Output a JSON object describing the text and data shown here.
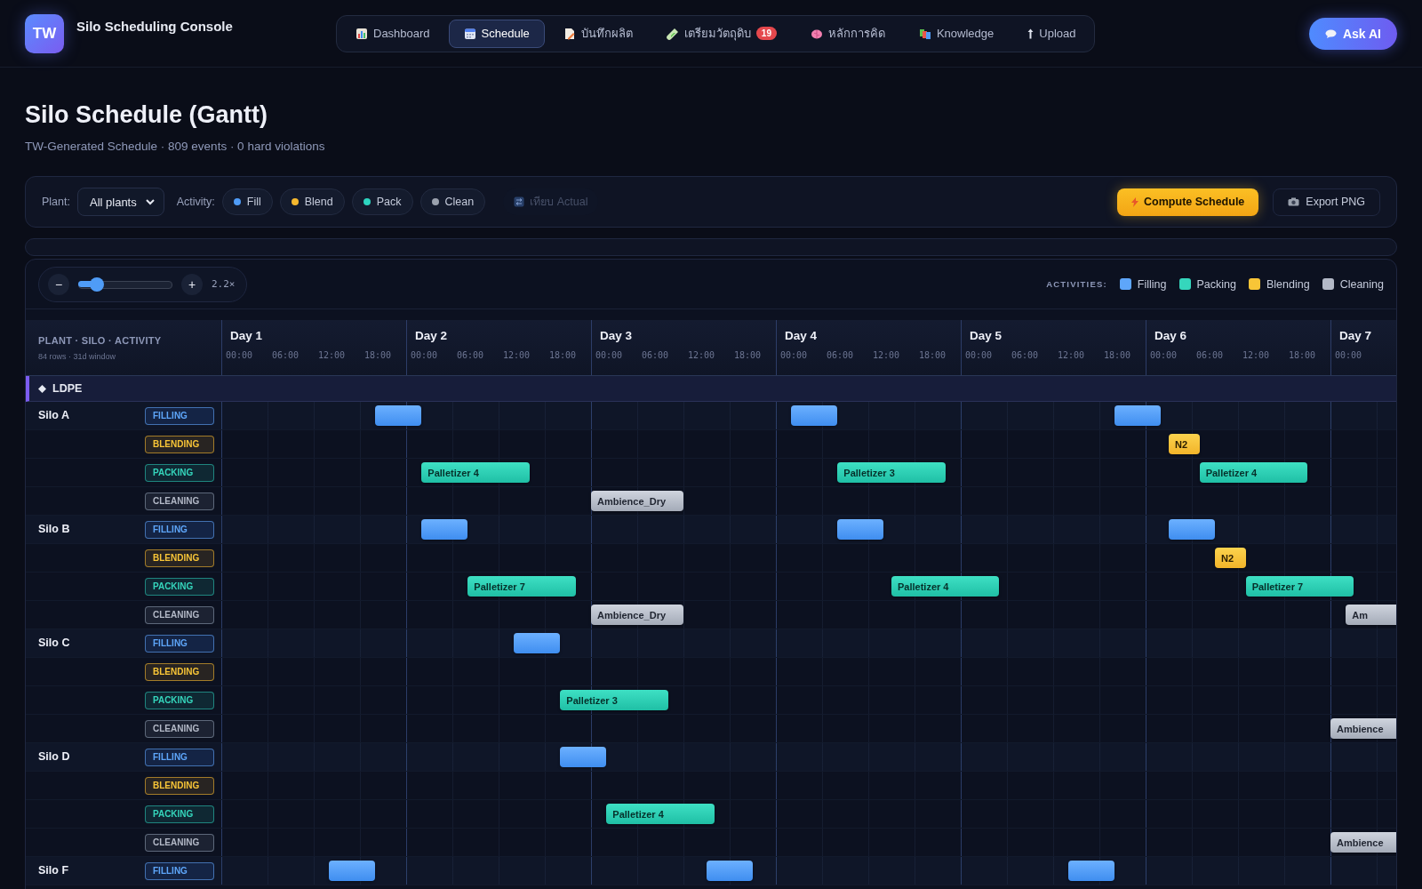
{
  "app": {
    "logo": "TW",
    "title": "Silo Scheduling Console"
  },
  "nav": [
    {
      "label": "Dashboard",
      "selected": false
    },
    {
      "label": "Schedule",
      "selected": true
    },
    {
      "label": "บันทึกผลิต",
      "selected": false
    },
    {
      "label": "เตรียมวัตถุดิบ",
      "badge": "19",
      "selected": false
    },
    {
      "label": "หลักการคิด",
      "selected": false
    },
    {
      "label": "Knowledge",
      "selected": false
    },
    {
      "label": "Upload",
      "selected": false
    }
  ],
  "ask_button": "Ask AI",
  "page": {
    "title": "Silo Schedule (Gantt)",
    "subtitle": "TW-Generated Schedule · 809 events · 0 hard violations"
  },
  "filters": {
    "plant_label": "Plant:",
    "plant_value": "All plants",
    "activity_label": "Activity:",
    "chips": [
      {
        "label": "Fill",
        "color": "#4f9cf7"
      },
      {
        "label": "Blend",
        "color": "#f5b82e"
      },
      {
        "label": "Pack",
        "color": "#2dd4bf"
      },
      {
        "label": "Clean",
        "color": "#9aa1ad"
      }
    ],
    "compare_button": {
      "label": "เทียบ Actual",
      "disabled": true
    },
    "compute_button": "Compute Schedule",
    "export_button": "Export PNG"
  },
  "zoom": {
    "minus": "−",
    "plus": "+",
    "level": 0.2,
    "reading": "2.2×"
  },
  "legend": {
    "title": "ACTIVITIES:",
    "items": [
      {
        "label": "Filling",
        "color": "#5ea6fa"
      },
      {
        "label": "Packing",
        "color": "#35d6bc"
      },
      {
        "label": "Blending",
        "color": "#f8c537"
      },
      {
        "label": "Cleaning",
        "color": "#b3b9c7"
      }
    ]
  },
  "gantt": {
    "header": "PLANT · SILO · ACTIVITY",
    "header_note": "84 rows · 31d window",
    "days": [
      {
        "label": "Day 1",
        "ticks": [
          "00:00",
          "06:00",
          "12:00",
          "18:00"
        ]
      },
      {
        "label": "Day 2",
        "ticks": [
          "00:00",
          "06:00",
          "12:00",
          "18:00"
        ]
      },
      {
        "label": "Day 3",
        "ticks": [
          "00:00",
          "06:00",
          "12:00",
          "18:00"
        ]
      },
      {
        "label": "Day 4",
        "ticks": [
          "00:00",
          "06:00",
          "12:00",
          "18:00"
        ]
      },
      {
        "label": "Day 5",
        "ticks": [
          "00:00",
          "06:00",
          "12:00",
          "18:00"
        ]
      },
      {
        "label": "Day 6",
        "ticks": [
          "00:00",
          "06:00",
          "12:00",
          "18:00"
        ]
      },
      {
        "label": "Day 7",
        "ticks": [
          "00:00"
        ]
      }
    ],
    "groups": [
      {
        "name": "LDPE",
        "silos": [
          {
            "name": "Silo A",
            "rows": [
              {
                "kind": "filling",
                "label": "FILLING",
                "bars": [
                  {
                    "kind": "bar"
                  },
                  {
                    "kind": "bar"
                  },
                  {
                    "kind": "bar"
                  }
                ]
              },
              {
                "kind": "blending",
                "label": "BLENDING",
                "bars": [
                  {
                    "kind": "bar",
                    "label": "N2"
                  }
                ]
              },
              {
                "kind": "packing",
                "label": "PACKING",
                "bars": [
                  {
                    "kind": "bar",
                    "label": "Palletizer 4"
                  },
                  {
                    "kind": "bar",
                    "label": "Palletizer 3"
                  },
                  {
                    "kind": "bar",
                    "label": "Palletizer 4"
                  }
                ]
              },
              {
                "kind": "cleaning",
                "label": "CLEANING",
                "bars": [
                  {
                    "kind": "bar",
                    "label": "Ambience_Dry"
                  }
                ]
              }
            ]
          },
          {
            "name": "Silo B",
            "rows": [
              {
                "kind": "filling",
                "label": "FILLING",
                "bars": [
                  {
                    "kind": "bar"
                  },
                  {
                    "kind": "bar"
                  },
                  {
                    "kind": "bar"
                  }
                ]
              },
              {
                "kind": "blending",
                "label": "BLENDING",
                "bars": [
                  {
                    "kind": "bar",
                    "label": "N2"
                  }
                ]
              },
              {
                "kind": "packing",
                "label": "PACKING",
                "bars": [
                  {
                    "kind": "bar",
                    "label": "Palletizer 7"
                  },
                  {
                    "kind": "bar",
                    "label": "Palletizer 4"
                  },
                  {
                    "kind": "bar",
                    "label": "Palletizer 7"
                  }
                ]
              },
              {
                "kind": "cleaning",
                "label": "CLEANING",
                "bars": [
                  {
                    "kind": "bar",
                    "label": "Ambience_Dry"
                  },
                  {
                    "kind": "bar",
                    "label": "Am"
                  }
                ]
              }
            ]
          },
          {
            "name": "Silo C",
            "rows": [
              {
                "kind": "filling",
                "label": "FILLING",
                "bars": [
                  {
                    "kind": "bar"
                  }
                ]
              },
              {
                "kind": "blending",
                "label": "BLENDING"
              },
              {
                "kind": "packing",
                "label": "PACKING",
                "bars": [
                  {
                    "kind": "bar",
                    "label": "Palletizer 3"
                  }
                ]
              },
              {
                "kind": "cleaning",
                "label": "CLEANING",
                "bars": [
                  {
                    "kind": "bar",
                    "label": "Ambience"
                  }
                ]
              }
            ]
          },
          {
            "name": "Silo D",
            "rows": [
              {
                "kind": "filling",
                "label": "FILLING",
                "bars": [
                  {
                    "kind": "bar"
                  }
                ]
              },
              {
                "kind": "blending",
                "label": "BLENDING"
              },
              {
                "kind": "packing",
                "label": "PACKING",
                "bars": [
                  {
                    "kind": "bar",
                    "label": "Palletizer 4"
                  }
                ]
              },
              {
                "kind": "cleaning",
                "label": "CLEANING",
                "bars": [
                  {
                    "kind": "bar",
                    "label": "Ambience"
                  }
                ]
              }
            ]
          },
          {
            "name": "Silo F",
            "rows": [
              {
                "kind": "filling",
                "label": "FILLING",
                "bars": [
                  {
                    "kind": "bar"
                  },
                  {
                    "kind": "bar"
                  },
                  {
                    "kind": "bar"
                  }
                ]
              }
            ]
          }
        ]
      }
    ]
  }
}
